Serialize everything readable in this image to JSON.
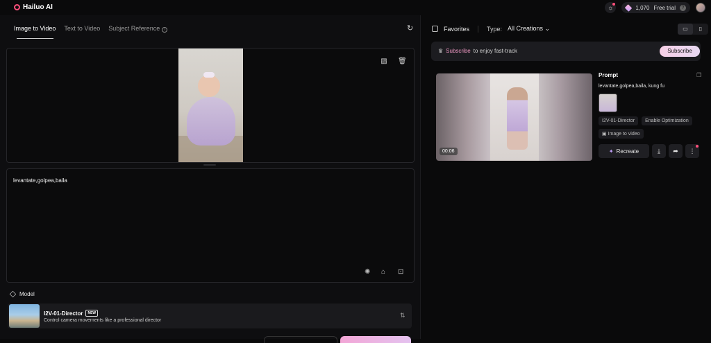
{
  "app": {
    "name": "Hailuo AI"
  },
  "topbar": {
    "credits": "1,070",
    "free_trial": "Free trial"
  },
  "tabs": [
    {
      "label": "Image to Video"
    },
    {
      "label": "Text to Video"
    },
    {
      "label": "Subject Reference"
    }
  ],
  "prompt": {
    "text": "levantate,golpea,baila"
  },
  "model": {
    "section_label": "Model",
    "name": "I2V-01-Director",
    "badge": "NEW",
    "description": "Control camera movements like a professional director"
  },
  "right": {
    "favorites_label": "Favorites",
    "type_label": "Type:",
    "type_value": "All Creations",
    "subscribe_text_pink": "Subscribe",
    "subscribe_text_rest": "to enjoy fast-track",
    "subscribe_button": "Subscribe",
    "video": {
      "duration": "00:06",
      "prompt_heading": "Prompt",
      "prompt_text": "levantate,golpea,baila, kung fu",
      "chips": [
        "I2V-01-Director",
        "Enable Optimization",
        "Image to video"
      ],
      "recreate_label": "Recreate"
    }
  },
  "colors": {
    "accent": "#ff4f7b",
    "subscribe_pink": "#f29ac6"
  }
}
